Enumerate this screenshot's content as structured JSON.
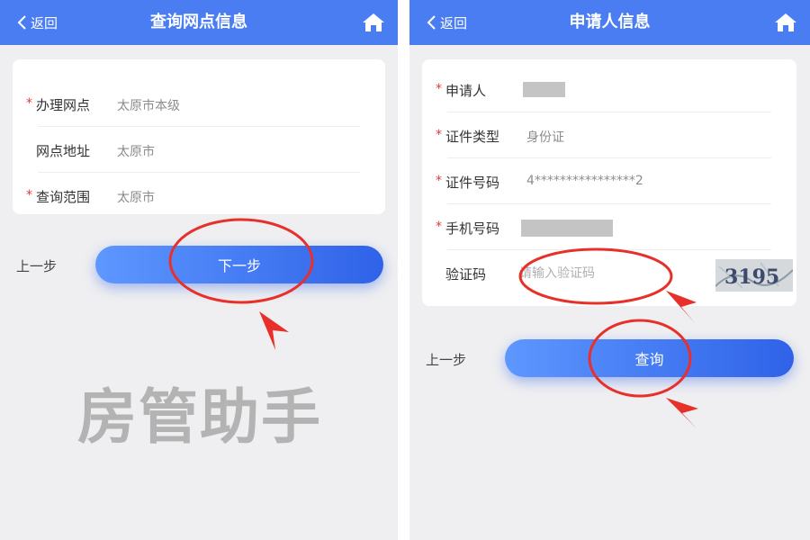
{
  "left": {
    "header": {
      "back_label": "返回",
      "title": "查询网点信息"
    },
    "fields": [
      {
        "required": true,
        "label": "办理网点",
        "value": "太原市本级"
      },
      {
        "required": false,
        "label": "网点地址",
        "value": "太原市"
      },
      {
        "required": true,
        "label": "查询范围",
        "value": "太原市"
      }
    ],
    "prev_label": "上一步",
    "next_label": "下一步",
    "watermark": "房管助手"
  },
  "right": {
    "header": {
      "back_label": "返回",
      "title": "申请人信息"
    },
    "fields": [
      {
        "required": true,
        "label": "申请人",
        "value": ""
      },
      {
        "required": true,
        "label": "证件类型",
        "value": "身份证"
      },
      {
        "required": true,
        "label": "证件号码",
        "value": "4****************2"
      },
      {
        "required": true,
        "label": "手机号码",
        "value": ""
      },
      {
        "required": false,
        "label": "验证码",
        "value": ""
      }
    ],
    "captcha_placeholder": "请输入验证码",
    "captcha_text": "3195",
    "prev_label": "上一步",
    "query_label": "查询"
  },
  "colors": {
    "header": "#4a7df1",
    "button_start": "#5e97ff",
    "button_end": "#2f62e8",
    "required_star": "#e23a3a",
    "annotation": "#e8302a"
  },
  "icons": [
    "back-chevron-icon",
    "home-icon",
    "red-arrow-icon"
  ]
}
